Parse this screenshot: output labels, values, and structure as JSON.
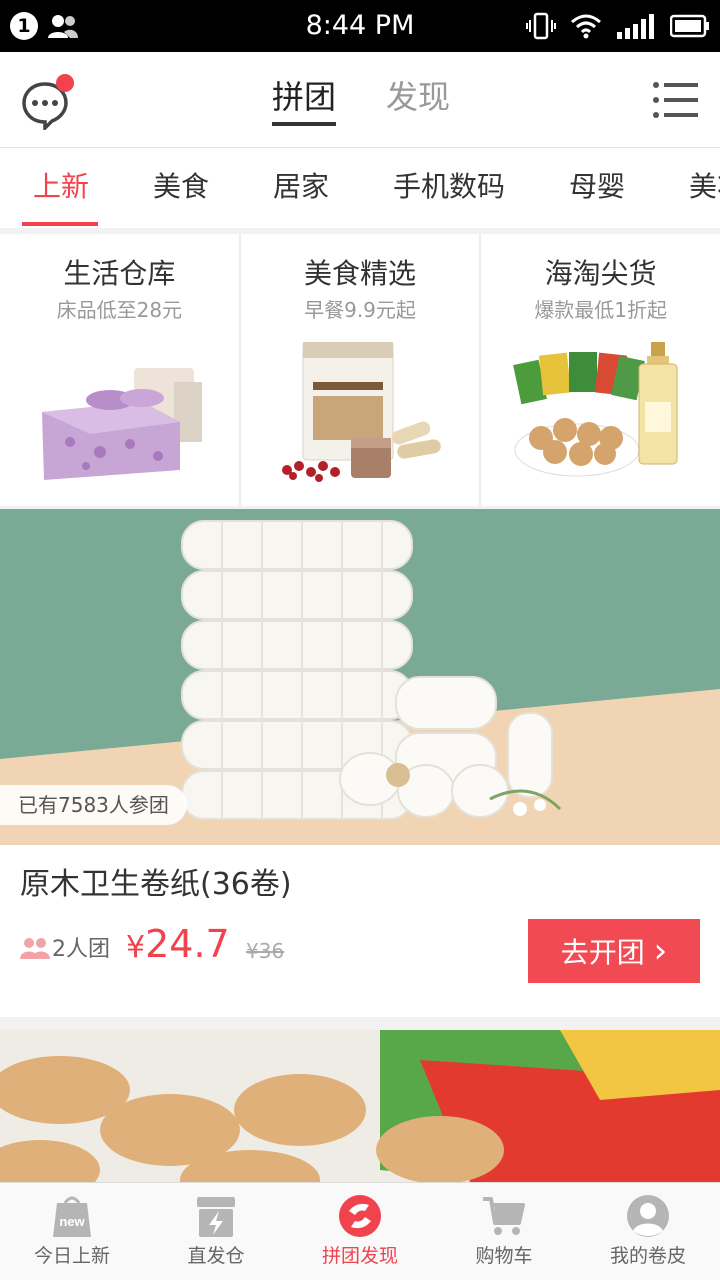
{
  "status_bar": {
    "notification_count": "1",
    "time": "8:44 PM"
  },
  "top_nav": {
    "tabs": [
      {
        "label": "拼团",
        "active": true
      },
      {
        "label": "发现",
        "active": false
      }
    ]
  },
  "categories": [
    {
      "label": "上新",
      "active": true
    },
    {
      "label": "美食"
    },
    {
      "label": "居家"
    },
    {
      "label": "手机数码"
    },
    {
      "label": "母婴"
    },
    {
      "label": "美妆"
    }
  ],
  "feature_panels": [
    {
      "title": "生活仓库",
      "subtitle": "床品低至28元",
      "image": "bed-image"
    },
    {
      "title": "美食精选",
      "subtitle": "早餐9.9元起",
      "image": "breakfast-powder-image"
    },
    {
      "title": "海淘尖货",
      "subtitle": "爆款最低1折起",
      "image": "snacks-perfume-image"
    }
  ],
  "product": {
    "participants": "已有7583人参团",
    "title": "原木卫生卷纸(36卷)",
    "group_size": "2人团",
    "currency": "¥",
    "price": "24.7",
    "original_price": "¥36",
    "cta_label": "去开团",
    "cta_arrow": "›"
  },
  "bottom_tabs": [
    {
      "label": "今日上新",
      "icon": "new-bag-icon",
      "badge": "new"
    },
    {
      "label": "直发仓",
      "icon": "lightning-box-icon"
    },
    {
      "label": "拼团发现",
      "icon": "group-discover-icon",
      "active": true
    },
    {
      "label": "购物车",
      "icon": "cart-icon"
    },
    {
      "label": "我的卷皮",
      "icon": "user-avatar-icon"
    }
  ],
  "colors": {
    "accent": "#f0434e",
    "button": "#f24a52",
    "hero_green": "#7aa996",
    "hero_peach": "#f1d4b4"
  }
}
